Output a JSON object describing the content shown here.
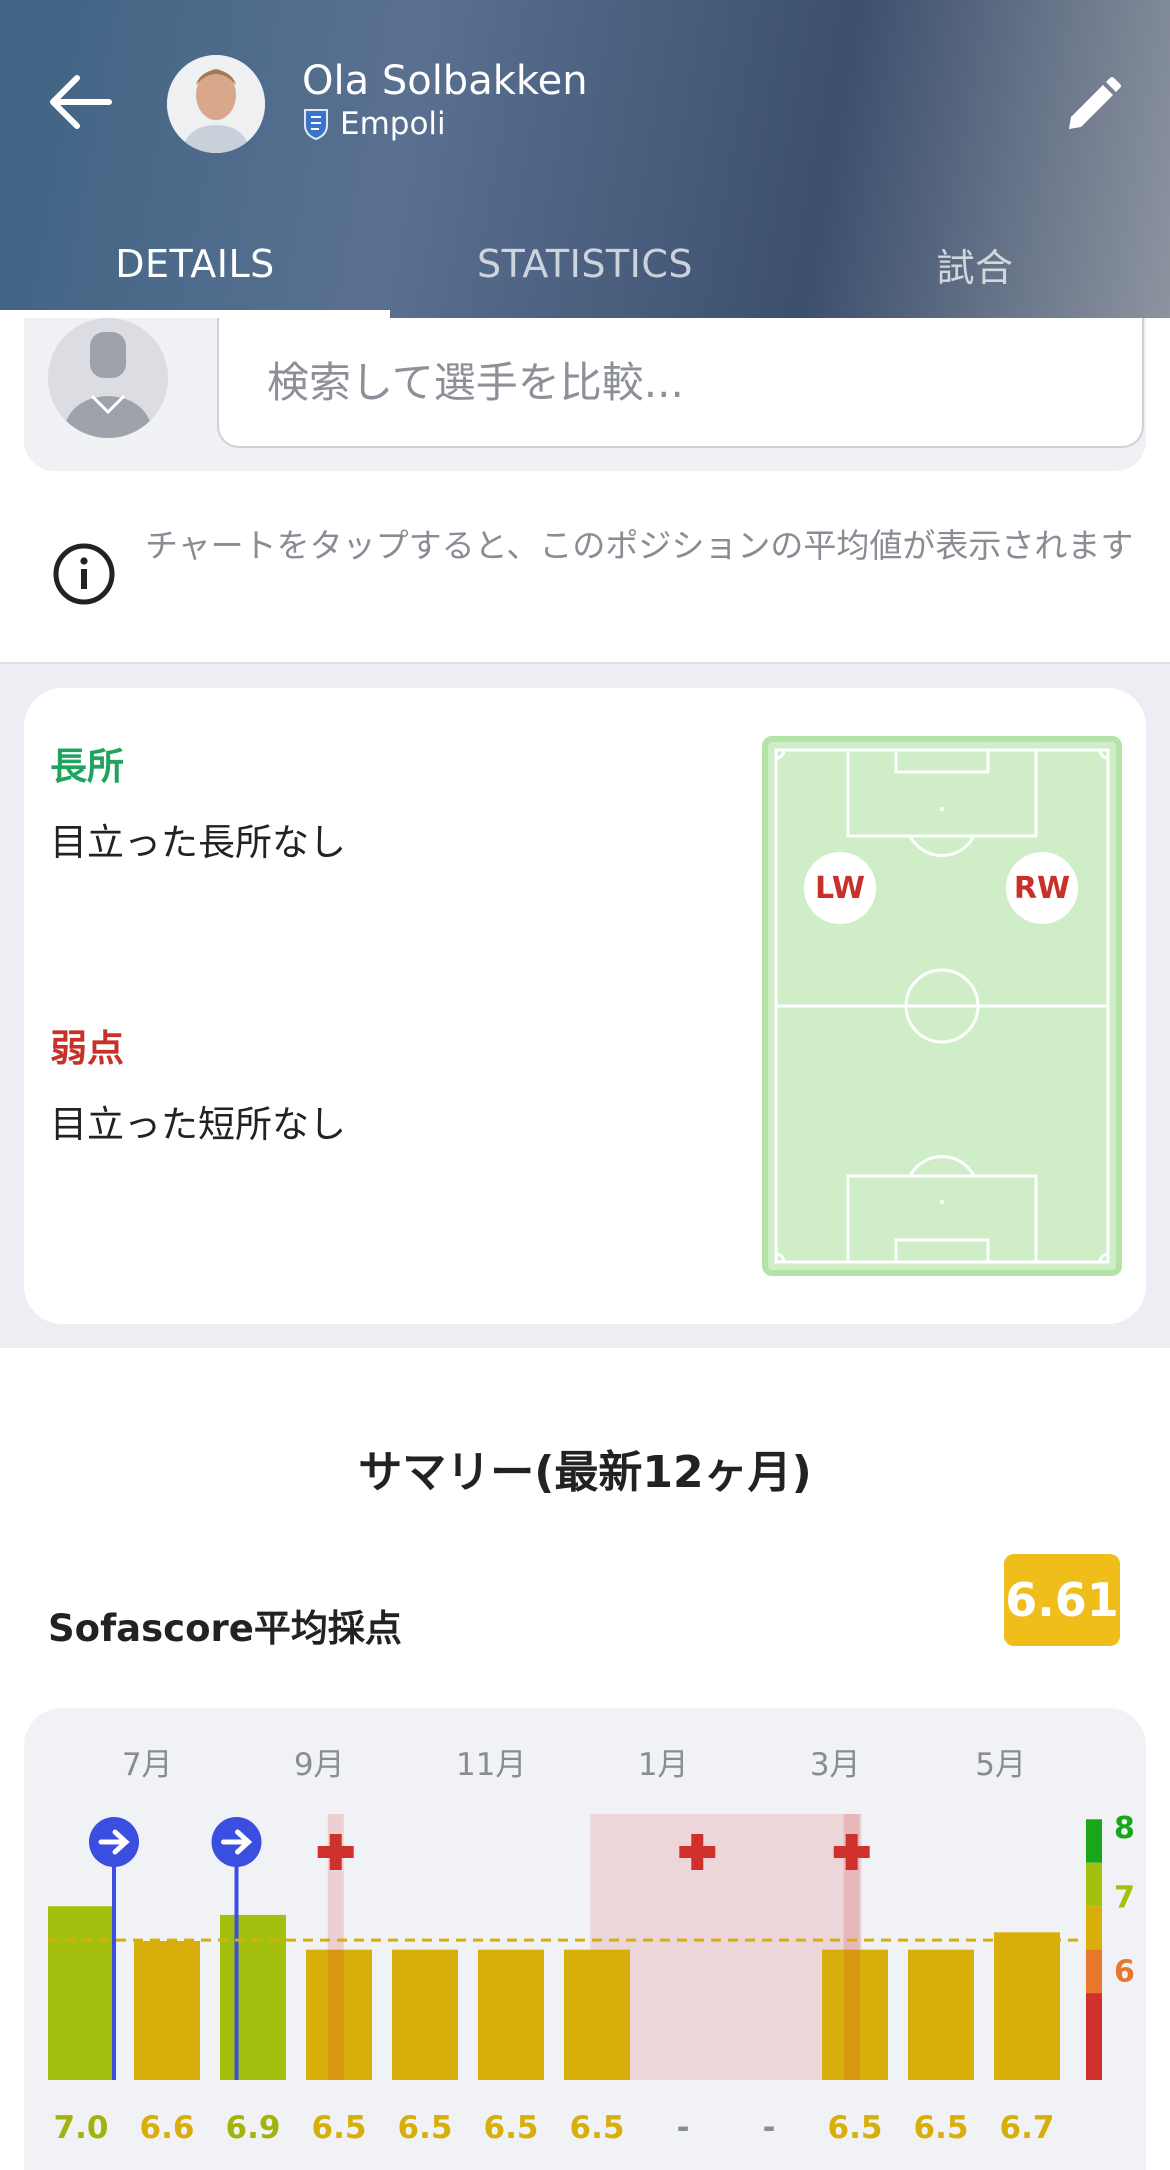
{
  "header": {
    "player_name": "Ola Solbakken",
    "team_name": "Empoli",
    "tabs": [
      {
        "label": "DETAILS",
        "active": true
      },
      {
        "label": "STATISTICS",
        "active": false
      },
      {
        "label": "試合",
        "active": false
      }
    ]
  },
  "compare": {
    "placeholder": "検索して選手を比較..."
  },
  "info": {
    "text": "チャートをタップすると、このポジションの平均値が表示されます"
  },
  "strengths": {
    "title": "長所",
    "value": "目立った長所なし"
  },
  "weaknesses": {
    "title": "弱点",
    "value": "目立った短所なし"
  },
  "positions": [
    "LW",
    "RW"
  ],
  "summary": {
    "title": "サマリー(最新12ヶ月)",
    "average_label": "Sofascore平均採点",
    "average_value": "6.61"
  },
  "colors": {
    "strength": "#1fa45d",
    "weakness": "#c8302a",
    "rating_yellow": "#d8ae0b",
    "rating_green": "#a4c00e",
    "transfer_blue": "#3a4ee0",
    "injury_red": "#d0312d"
  },
  "chart_data": {
    "type": "bar",
    "month_labels": [
      "7月",
      "9月",
      "11月",
      "1月",
      "3月",
      "5月"
    ],
    "ratings": [
      "7.0",
      "6.6",
      "6.9",
      "6.5",
      "6.5",
      "6.5",
      "6.5",
      "-",
      "-",
      "6.5",
      "6.5",
      "6.7"
    ],
    "values": [
      7.0,
      6.6,
      6.9,
      6.5,
      6.5,
      6.5,
      6.5,
      null,
      null,
      6.5,
      6.5,
      6.7
    ],
    "average": 6.61,
    "scale_labels": [
      "8",
      "7",
      "6"
    ],
    "transfer_events": [
      0,
      2
    ],
    "injury_events": [
      3,
      9
    ]
  }
}
